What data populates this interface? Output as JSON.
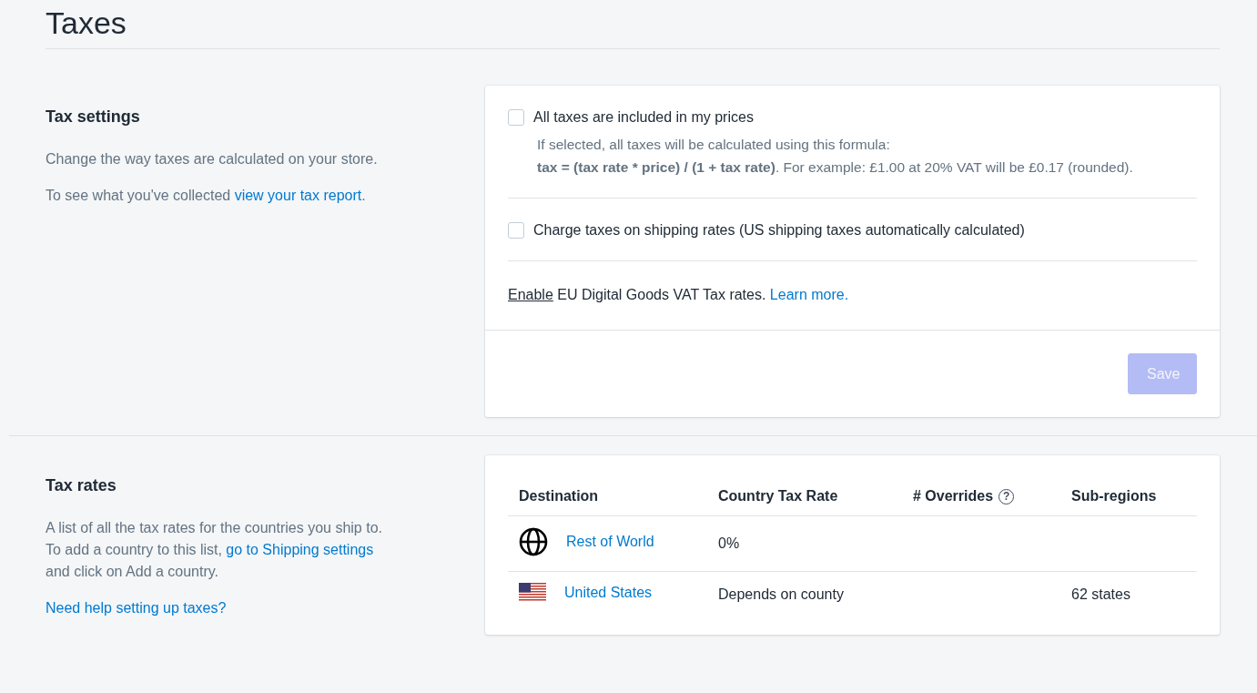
{
  "page_title": "Taxes",
  "tax_settings": {
    "heading": "Tax settings",
    "paragraphs": [
      [
        {
          "kind": "plain",
          "text": "Change the way taxes are calculated on your store."
        }
      ],
      [
        {
          "kind": "plain",
          "text": "To see what you've collected "
        },
        {
          "kind": "link",
          "text": "view your tax report"
        },
        {
          "kind": "plain",
          "text": "."
        }
      ]
    ],
    "options": [
      {
        "label": "All taxes are included in my prices",
        "checked": false,
        "help_lines": [
          "If selected, all taxes will be calculated using this formula:",
          "**tax = (tax rate * price) / (1 + tax rate)**. For example: £1.00 at 20% VAT will be £0.17 (rounded)."
        ]
      },
      {
        "label": "Charge taxes on shipping rates (US shipping taxes automatically calculated)",
        "checked": false
      }
    ],
    "eu_note": [
      {
        "kind": "underline",
        "text": "Enable"
      },
      {
        "kind": "plain",
        "text": " EU Digital Goods VAT Tax rates. "
      },
      {
        "kind": "link",
        "text": "Learn more."
      }
    ],
    "save_button": {
      "label": "Save",
      "disabled": true
    }
  },
  "tax_rates": {
    "heading": "Tax rates",
    "paragraphs": [
      [
        {
          "kind": "plain",
          "text": "A list of all the tax rates for the countries you ship to. To add a country to this list, "
        },
        {
          "kind": "link",
          "text": "go to Shipping settings"
        },
        {
          "kind": "plain",
          "text": " and click on Add a country."
        }
      ],
      [
        {
          "kind": "link",
          "text": "Need help setting up taxes?"
        }
      ]
    ],
    "table": {
      "columns": [
        {
          "label": "Destination"
        },
        {
          "label": "Country Tax Rate"
        },
        {
          "label": "# Overrides",
          "help_icon": "?"
        },
        {
          "label": "Sub-regions"
        }
      ],
      "rows": [
        {
          "kind": "globe",
          "destination": "Rest of World",
          "rate": "0%"
        },
        {
          "kind": "flag",
          "destination": "United States",
          "rate": "Depends on county",
          "subregions": "62 states"
        }
      ]
    }
  }
}
